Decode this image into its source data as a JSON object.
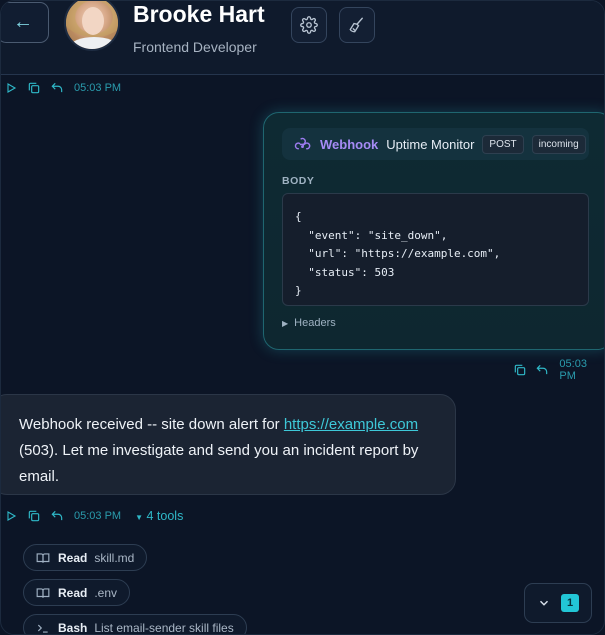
{
  "header": {
    "back_icon": "arrow-left-icon",
    "user_name": "Brooke Hart",
    "user_role": "Frontend Developer",
    "settings_icon": "gear-icon",
    "clear_icon": "broom-icon"
  },
  "messages": {
    "first_meta": {
      "time": "05:03 PM"
    },
    "webhook": {
      "brand": "Webhook",
      "title": "Uptime Monitor",
      "method": "POST",
      "direction": "incoming",
      "body_label": "BODY",
      "body_code": "{\n  \"event\": \"site_down\",\n  \"url\": \"https://example.com\",\n  \"status\": 503\n}",
      "headers_label": "Headers",
      "time": "05:03 PM"
    },
    "assistant": {
      "text_before": "Webhook received -- site down alert for ",
      "link": "https://example.com",
      "text_after": " (503). Let me investigate and send you an incident report by email.",
      "time": "05:03 PM",
      "tools_label": "4 tools"
    },
    "tools": [
      {
        "verb": "Read",
        "arg": "skill.md",
        "icon": "book-icon"
      },
      {
        "verb": "Read",
        "arg": ".env",
        "icon": "book-icon"
      },
      {
        "verb": "Bash",
        "arg": "List email-sender skill files",
        "icon": "terminal-icon"
      }
    ]
  },
  "scroll": {
    "unread_count": "1",
    "icon": "chevron-down-icon"
  },
  "colors": {
    "accent": "#22c6d6",
    "brand": "#a58bf5",
    "background": "#0c1526"
  }
}
